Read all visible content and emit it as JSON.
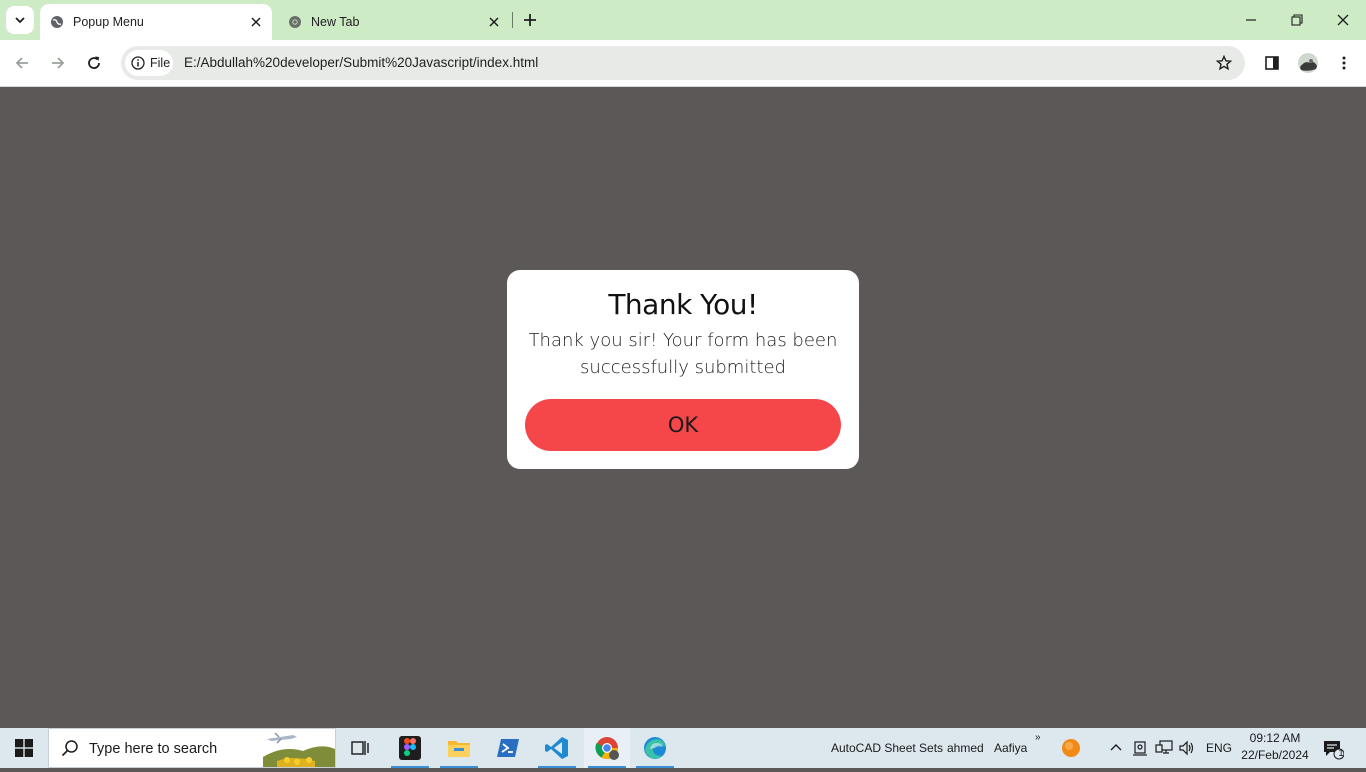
{
  "browser": {
    "tabs": [
      {
        "title": "Popup Menu",
        "active": true
      },
      {
        "title": "New Tab",
        "active": false
      }
    ],
    "address": {
      "scheme_label": "File",
      "url": "E:/Abdullah%20developer/Submit%20Javascript/index.html"
    }
  },
  "popup": {
    "title": "Thank You!",
    "message": "Thank you sir! Your form has been successfully submitted",
    "button_label": "OK",
    "button_color": "#f5474a"
  },
  "page": {
    "overlay_color": "#5c5857"
  },
  "taskbar": {
    "search_placeholder": "Type here to search",
    "tray_labels": [
      "AutoCAD Sheet Sets",
      "ahmed",
      "Aafiya"
    ],
    "overflow_glyph": "»",
    "language": "ENG",
    "time": "09:12 AM",
    "date": "22/Feb/2024",
    "notification_count": "1"
  },
  "icons": {
    "browser": [
      "tab-search-icon",
      "globe-icon",
      "close-icon",
      "plus-icon",
      "minimize-icon",
      "restore-icon",
      "back-icon",
      "forward-icon",
      "reload-icon",
      "info-icon",
      "star-icon",
      "side-panel-icon",
      "profile-avatar-icon",
      "more-vert-icon"
    ],
    "taskbar": [
      "windows-logo-icon",
      "search-icon",
      "task-view-icon",
      "figma-icon",
      "file-explorer-icon",
      "powershell-icon",
      "vscode-icon",
      "chrome-icon",
      "edge-icon",
      "orange-circle-icon",
      "chevron-up-icon",
      "meet-icon",
      "network-icon",
      "volume-icon",
      "notification-icon"
    ]
  }
}
